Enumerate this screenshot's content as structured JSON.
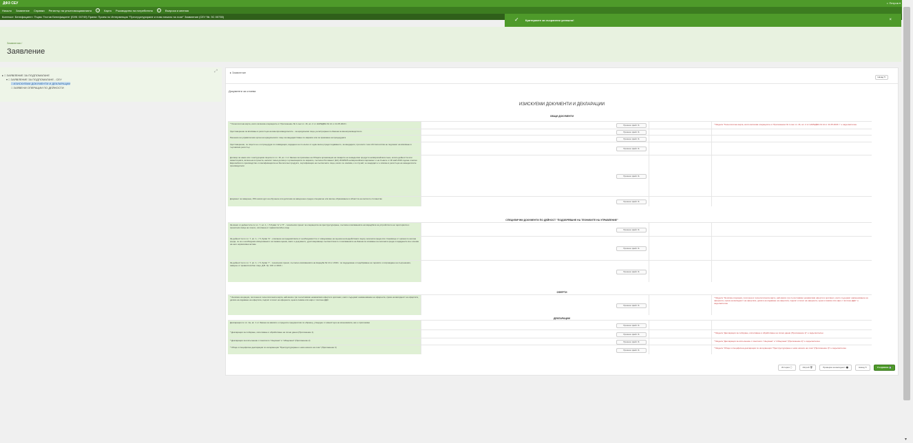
{
  "app": {
    "brand": "ДФЗ СЕУ",
    "user": "r. Петров ▾"
  },
  "nav": [
    "Начало",
    "Заявление",
    "Справки",
    "Регистър на упълномощаванията",
    "+",
    "Карта",
    "Ръководство на потребителя",
    "+",
    "Въпроси и мнения"
  ],
  "info": "Контекст: Бенефициент: Първо Тестов Бенефициент (ЕИК: 00749) Прием: Прием по Интервенция \"Преструктуриране и ново начало на лозе\" Заявление (СЕУ №: ЗС 00735)",
  "toast": {
    "icon": "✓",
    "message": "Критериите за съхранени успешно!",
    "close": "×"
  },
  "header": {
    "breadcrumb": "Заявления /",
    "title": "Заявление"
  },
  "sidebar": {
    "expand_icon": "⤢",
    "tree": [
      "▸ □ ЗАЯВЛЕНИЕ ЗА ПОДПОМАГАНЕ",
      "▾ □ ЗАЯВЛЕНИЕ ЗА ПОДПОМАГАНЕ - СЕУ",
      "□ ИЗИСКУЕМИ ДОКУМЕНТИ И ДЕКЛАРАЦИИ",
      "□ ЗАЯВЕНИ ОПЕРАЦИИ ПО ДЕЙНОСТИ"
    ]
  },
  "main": {
    "section": "▸ Заявление",
    "back": "Назад ↻",
    "sub": "Документи за слоева",
    "doc_title": "ИЗИСКУЕМИ ДОКУМЕНТИ И ДЕКЛАРАЦИИ",
    "upload_label": "Прикачи файл ⇅",
    "groups": [
      "ОБЩИ ДОКУМЕНТИ",
      "СПЕЦИФИЧНИ ДОКУМЕНТИ ПО ДЕЙНОСТ \"ПОДОБРЯВАНЕ НА ТЕХНИКИТЕ НА УПРАВЛЕНИЕ\"",
      "ОФЕРТИ",
      "ДЕКЛАРАЦИИ"
    ],
    "rows": [
      {
        "desc": "* Технологична карта, която включва операциите от Приложение № 1 към чл. 16, ал. 2 от НАРЕДБА № 14 от 11.05.2023 г.",
        "error": "* Модела \"Технологична карта, която включва операциите от Приложение № 1 към чл. 16, ал. 2 от НАРЕДБА № 14 от 11.05.2023 г.\" е задължителен"
      },
      {
        "desc": "Удостоверение за вписване в регистъра на винопроизводителите - за юридически лица, регистрирани по Закона за винопроизводството",
        "error": ""
      },
      {
        "desc": "Решение на управителния орган на юридическото лице за кандидатстване по мярката или за приемане на процедурата",
        "error": ""
      },
      {
        "desc": "Удостоверение, че лицето не е в процедура по ликвидация, издадено не по-късно от един месец преди подаването, за кандидати, при които тези обстоятелства не подлежат на вписване в търговския регистър",
        "error": ""
      },
      {
        "desc": "Договор за наем или с инструкциям лицата по чл. 16, ал. 1 от Закона за прилагане на Общата организация на пазарите на земеделски продукти на Европейския съюз, когато дейността или инвестицията, включена в проекта, налагат такъв договор с организацията по мярката, съгласно Регламент (ЕС) 2019/945 на Европейския парламент и на Съвета от 30 май 2019 година относно Европейското производство и класификацията на биологични продукти, сертификация на съответните лица, когато се изисква, и в случай, че кандидатът е вписан в регистъра на земеделските производители",
        "error": ""
      },
      {
        "desc": "Документ за заверена, 156-часов курс на обучение или диплома за завършено средно специално или висше образование в областта на селското стопанство",
        "error": ""
      },
      {
        "desc": "За всеки от дейностите по чл. 7, ал. 1, т. 5 букви \"а\" и \"б\" - технически проект за операцията за преструктуриране, съгласно изискванията на Наредбата за устройството на територията и проектния скица на лозето, изготвена от правоспособно лице",
        "error": ""
      },
      {
        "desc": "За дейността по чл. 7, ал. 1, т. 5, буква \"в\" - описание на предимствата от необходимостта от извършване на оценка на въздействието върху околната среда или становище от органа по околна среда, че не е необходимо извършването на такава оценка, както и документи, удостоверяващи съответствието с изискванията на Закона за опазване на околната среда и издадените въз основа на него нормативни актове",
        "error": ""
      },
      {
        "desc": "За дейността по чл. 7, ал. 1, т. 5, буква \"г\" - технически проект, съгласно изискванията на Наредба № 10 от 2016 г. за поддържане и подобряване на терасите и изграждане на съоръжения, заверен от правоспособно лице, Д.В. бр. 100 от 2016 г.",
        "error": ""
      },
      {
        "desc": "* За всяка операция, посочена в технологичната карта, най-малко три съпоставими независими оферти в оригинал, които съдържат наименование на оферента, срока на валидност на офертата, датата на издаване на офертата, подпис и печат на оферента, цена в левове или евро с посочен ДДС",
        "error": "* Модела \"За всяка операция, посочена в технологичната карта, най-малко три съпоставими независими оферти в оригинал, които съдържат наименование на оферента, срока на валидност на офертата, датата на издаване на офертата, подпис и печат на оферента, цена в левове или евро с посочен ДДС\" е задължителен"
      },
      {
        "desc": "Декларация по чл. 4а, ал. 1 от Закона за малките и средните предприятия по образец, утвърден от министъра на икономиката, ако е приложимо",
        "error": ""
      },
      {
        "desc": "* Декларация за събиране, използване и обработване на лични данни (Приложение 1)",
        "error": "* Модела \"Декларация за събиране, използване и обработване на лични данни (Приложение 1)\" е задължителен"
      },
      {
        "desc": "* Декларация за изпълнение с понятието \"свързани\" и \"обвързани\" (Приложение 2)",
        "error": "* Модела \"Декларация за изпълнение с понятието \"свързани\" и \"обвързани\" (Приложение 2)\" е задължителен"
      },
      {
        "desc": "* Обща и специфична декларация по интервенция \"Преструктуриране и ново начало на лозе\" (Приложение 3)",
        "error": "* Модела \"Обща и специфична декларация по интервенция \"Преструктуриране и ново начало на лозе\" (Приложение 3)\" е задължителен"
      }
    ],
    "footer": {
      "history": "История ⓘ",
      "delete": "Изтрий 🗑",
      "check": "Проверка за валидност ⬤",
      "back": "Назад ↻",
      "save": "Създаване 💾"
    }
  },
  "scrollbar": {
    "down_arrow": "▾"
  }
}
